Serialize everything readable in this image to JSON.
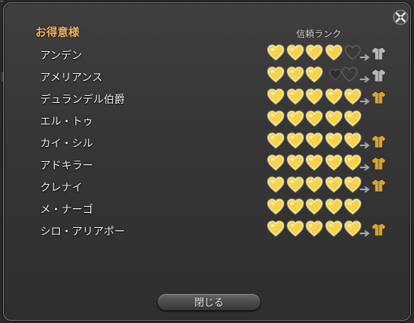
{
  "window": {
    "title": "お得意様",
    "rank_header": "信頼ランク",
    "close_button_label": "閉じる"
  },
  "clients": [
    {
      "name": "アンデン",
      "gold_hearts": 4,
      "dark_hearts": 1,
      "max_hearts": 5,
      "reward_tier": "silver"
    },
    {
      "name": "アメリアンス",
      "gold_hearts": 3,
      "dark_hearts": 1,
      "max_hearts": 5,
      "reward_tier": "silver",
      "extra_dim_heart": true
    },
    {
      "name": "デュランデル伯爵",
      "gold_hearts": 5,
      "dark_hearts": 0,
      "max_hearts": 5,
      "reward_tier": "gold"
    },
    {
      "name": "エル・トゥ",
      "gold_hearts": 5,
      "dark_hearts": 0,
      "max_hearts": 5,
      "reward_tier": "none"
    },
    {
      "name": "カイ・シル",
      "gold_hearts": 5,
      "dark_hearts": 0,
      "max_hearts": 5,
      "reward_tier": "gold"
    },
    {
      "name": "アドキラー",
      "gold_hearts": 5,
      "dark_hearts": 0,
      "max_hearts": 5,
      "reward_tier": "gold"
    },
    {
      "name": "クレナイ",
      "gold_hearts": 5,
      "dark_hearts": 0,
      "max_hearts": 5,
      "reward_tier": "gold"
    },
    {
      "name": "メ・ナーゴ",
      "gold_hearts": 5,
      "dark_hearts": 0,
      "max_hearts": 5,
      "reward_tier": "none"
    },
    {
      "name": "シロ・アリアポー",
      "gold_hearts": 5,
      "dark_hearts": 0,
      "max_hearts": 5,
      "reward_tier": "gold"
    }
  ],
  "colors": {
    "title": "#f0b55c",
    "heart_gold": "#f7d34a",
    "heart_dark": "#3a3a3a",
    "shirt_silver": "#b8b8b8",
    "shirt_gold": "#d9a531"
  },
  "icons": {
    "close": "close-x-icon",
    "heart": "heart-icon",
    "arrow": "arrow-right-icon",
    "shirt": "jacket-icon"
  }
}
